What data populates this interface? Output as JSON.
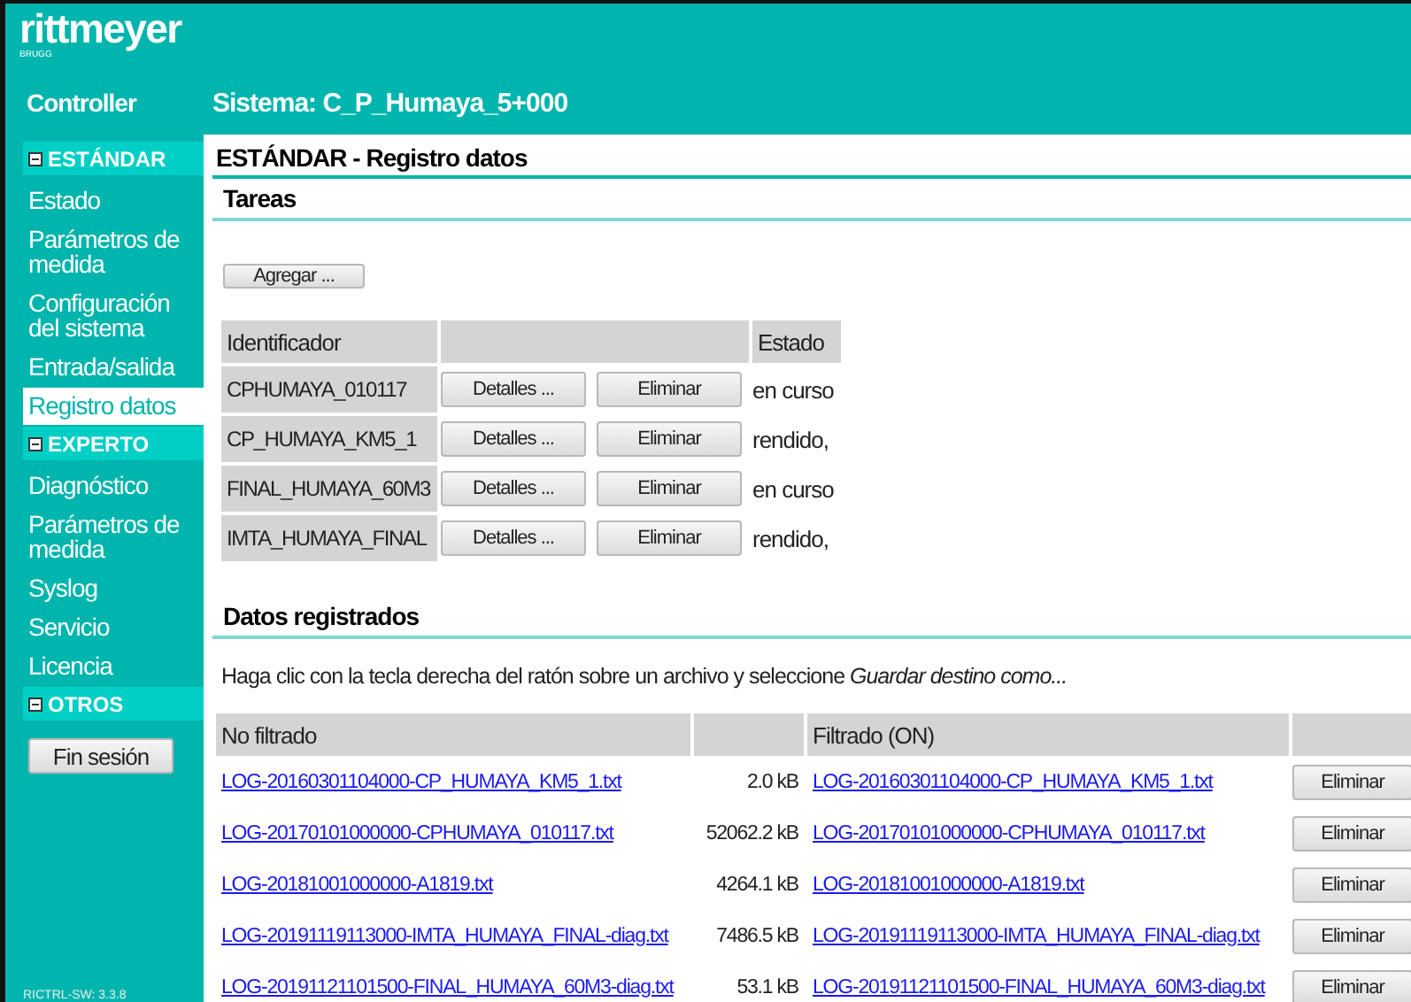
{
  "header": {
    "logo": "rittmeyer",
    "logo_sub": "BRUGG",
    "product": "Controller",
    "system": "Sistema: C_P_Humaya_5+000"
  },
  "sidebar": {
    "sections": [
      {
        "title": "ESTÁNDAR",
        "items": [
          {
            "label": "Estado",
            "selected": false
          },
          {
            "label": "Parámetros de medida",
            "selected": false
          },
          {
            "label": "Configuración del sistema",
            "selected": false
          },
          {
            "label": "Entrada/salida",
            "selected": false
          },
          {
            "label": "Registro datos",
            "selected": true
          }
        ]
      },
      {
        "title": "EXPERTO",
        "items": [
          {
            "label": "Diagnóstico",
            "selected": false
          },
          {
            "label": "Parámetros de medida",
            "selected": false
          },
          {
            "label": "Syslog",
            "selected": false
          },
          {
            "label": "Servicio",
            "selected": false
          },
          {
            "label": "Licencia",
            "selected": false
          }
        ]
      },
      {
        "title": "OTROS"
      }
    ],
    "logout_button": "Fin sesión",
    "version": "RICTRL-SW: 3.3.8"
  },
  "page_title": "ESTÁNDAR - Registro datos",
  "tasks": {
    "title": "Tareas",
    "add_button": "Agregar ...",
    "columns": [
      "Identificador",
      "Estado"
    ],
    "rows": [
      {
        "id": "CPHUMAYA_010117",
        "details": "Detalles ...",
        "delete": "Eliminar",
        "status": "en curso"
      },
      {
        "id": "CP_HUMAYA_KM5_1",
        "details": "Detalles ...",
        "delete": "Eliminar",
        "status": "rendido,"
      },
      {
        "id": "FINAL_HUMAYA_60M3",
        "details": "Detalles ...",
        "delete": "Eliminar",
        "status": "en curso"
      },
      {
        "id": "IMTA_HUMAYA_FINAL",
        "details": "Detalles ...",
        "delete": "Eliminar",
        "status": "rendido,"
      }
    ]
  },
  "data": {
    "title": "Datos registrados",
    "hint": "Haga clic con la tecla derecha del ratón sobre un archivo y seleccione *Guardar destino como...*",
    "columns": [
      "No filtrado",
      "Filtrado (ON)"
    ],
    "rows": [
      {
        "file": "LOG-20160301104000-CP_HUMAYA_KM5_1.txt",
        "size": "2.0 kB",
        "filtered": "LOG-20160301104000-CP_HUMAYA_KM5_1.txt",
        "delete": "Eliminar"
      },
      {
        "file": "LOG-20170101000000-CPHUMAYA_010117.txt",
        "size": "52062.2 kB",
        "filtered": "LOG-20170101000000-CPHUMAYA_010117.txt",
        "delete": "Eliminar"
      },
      {
        "file": "LOG-20181001000000-A1819.txt",
        "size": "4264.1 kB",
        "filtered": "LOG-20181001000000-A1819.txt",
        "delete": "Eliminar"
      },
      {
        "file": "LOG-20191119113000-IMTA_HUMAYA_FINAL-diag.txt",
        "size": "7486.5 kB",
        "filtered": "LOG-20191119113000-IMTA_HUMAYA_FINAL-diag.txt",
        "delete": "Eliminar"
      },
      {
        "file": "LOG-20191121101500-FINAL_HUMAYA_60M3-diag.txt",
        "size": "53.1 kB",
        "filtered": "LOG-20191121101500-FINAL_HUMAYA_60M3-diag.txt",
        "delete": "Eliminar"
      }
    ]
  }
}
